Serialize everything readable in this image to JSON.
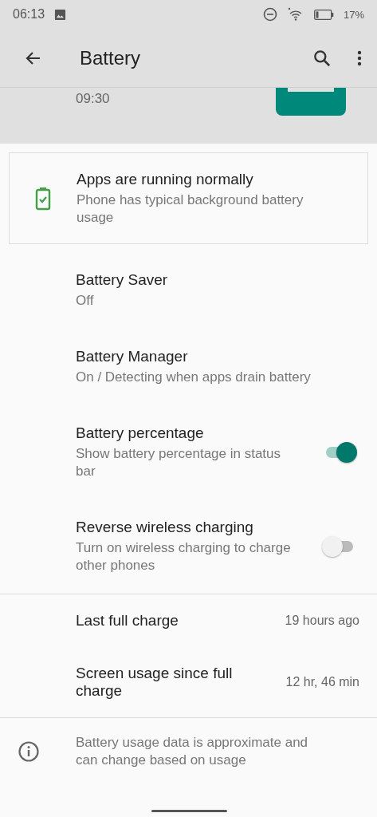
{
  "status_bar": {
    "time": "06:13",
    "battery": "17%"
  },
  "app_bar": {
    "title": "Battery"
  },
  "header": {
    "time": "09:30"
  },
  "status_card": {
    "title": "Apps are running normally",
    "subtitle": "Phone has typical background battery usage"
  },
  "settings": [
    {
      "kind": "text",
      "title": "Battery Saver",
      "subtitle": "Off"
    },
    {
      "kind": "text",
      "title": "Battery Manager",
      "subtitle": "On / Detecting when apps drain battery"
    },
    {
      "kind": "toggle",
      "title": "Battery percentage",
      "subtitle": "Show battery percentage in status bar",
      "on": true
    },
    {
      "kind": "toggle",
      "title": "Reverse wireless charging",
      "subtitle": "Turn on wireless charging to charge other phones",
      "on": false
    }
  ],
  "stats": [
    {
      "label": "Last full charge",
      "value": "19 hours ago"
    },
    {
      "label": "Screen usage since full charge",
      "value": "12 hr, 46 min"
    }
  ],
  "footer": {
    "text": "Battery usage data is approximate and can change based on usage"
  }
}
